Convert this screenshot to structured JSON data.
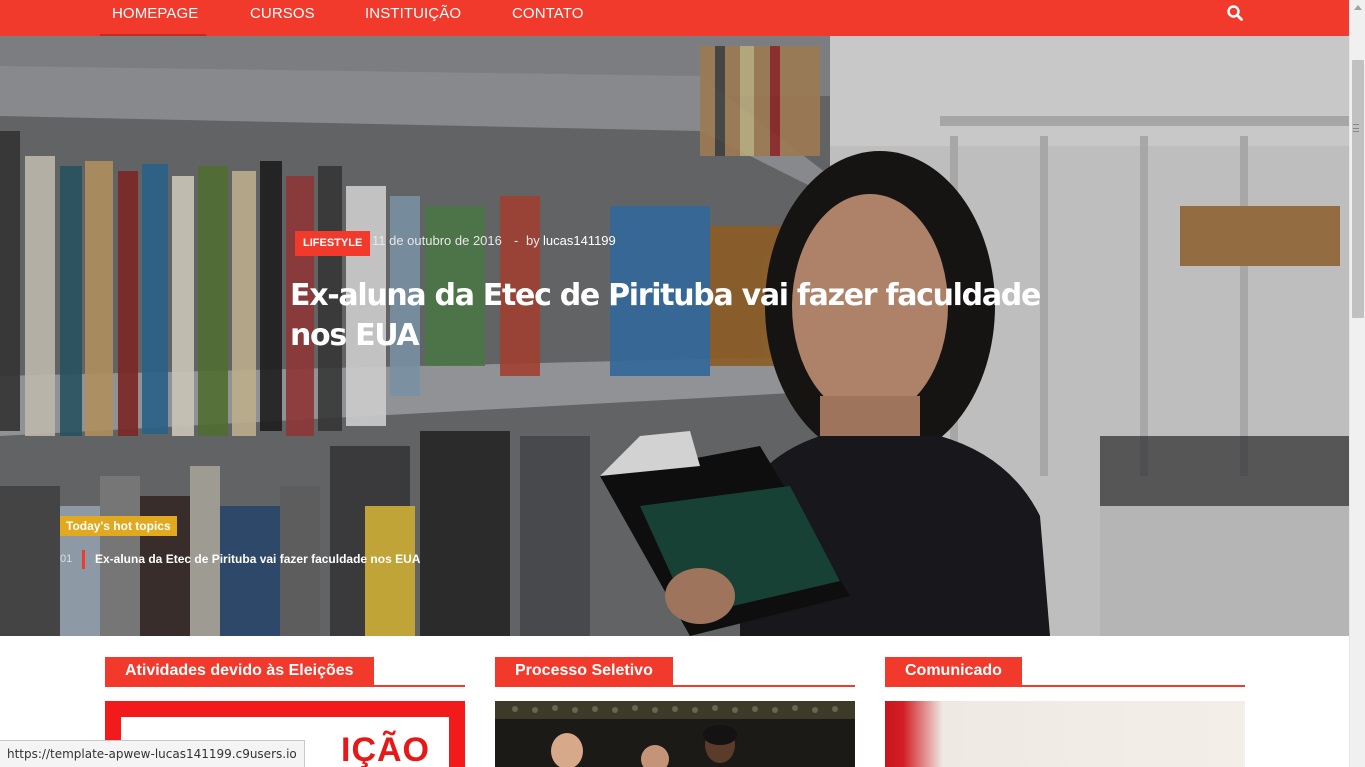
{
  "nav": {
    "items": [
      {
        "label": "HOMEPAGE",
        "active": true
      },
      {
        "label": "CURSOS"
      },
      {
        "label": "INSTITUIÇÃO"
      },
      {
        "label": "CONTATO"
      }
    ],
    "search_icon": "search-icon"
  },
  "hero": {
    "category": "LIFESTYLE",
    "date": "11 de outubro de 2016",
    "separator": "-",
    "by": "by",
    "author": "lucas141199",
    "title": "Ex-aluna da Etec de Pirituba vai fazer faculdade nos EUA"
  },
  "hot_topics": {
    "label": "Today's hot topics",
    "items": [
      {
        "num": "01",
        "title": "Ex-aluna da Etec de Pirituba vai fazer faculdade nos EUA"
      }
    ]
  },
  "sections": [
    {
      "title": "Atividades devido às Eleições"
    },
    {
      "title": "Processo Seletivo"
    },
    {
      "title": "Comunicado"
    }
  ],
  "thumb1_text": "IÇÃO",
  "status_url": "https://template-apwew-lucas141199.c9users.io",
  "colors": {
    "accent": "#f13a2b",
    "hot_topics": "#e0a91f"
  }
}
